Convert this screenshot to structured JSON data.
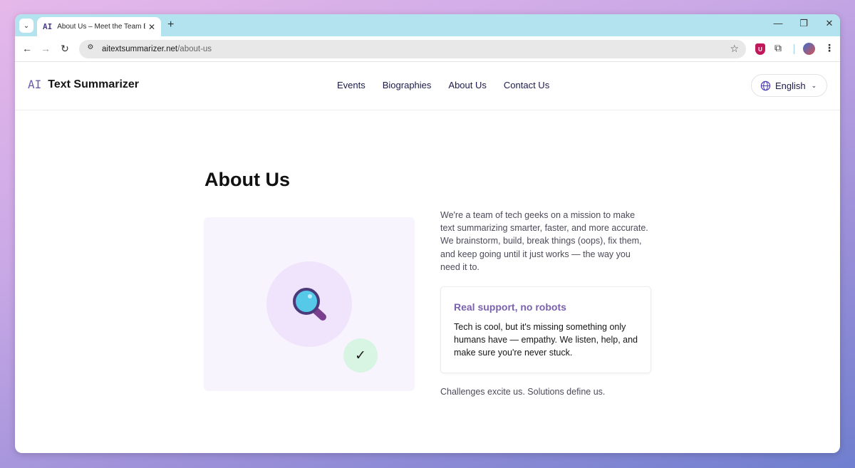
{
  "browser": {
    "tab": {
      "favicon": "AI",
      "title": "About Us – Meet the Team Behi",
      "close_glyph": "✕"
    },
    "new_tab_glyph": "+",
    "tab_menu_glyph": "⌄",
    "window_controls": {
      "minimize": "—",
      "restore": "❐",
      "close": "✕"
    },
    "nav": {
      "back": "←",
      "forward": "→",
      "reload": "↻"
    },
    "address": {
      "host": "aitextsummarizer.net",
      "path": "/about-us"
    },
    "star_glyph": "☆",
    "ublock_label": "U",
    "kebab_glyph": "⋮",
    "puzzle_glyph": "⧉",
    "site_info_glyph": "⚙"
  },
  "site": {
    "logo_mark": "AI",
    "logo_text": "Text Summarizer",
    "nav": [
      {
        "label": "Events"
      },
      {
        "label": "Biographies"
      },
      {
        "label": "About Us"
      },
      {
        "label": "Contact Us"
      }
    ],
    "language": {
      "label": "English",
      "chevron": "⌄"
    }
  },
  "main": {
    "title": "About Us",
    "intro": "We're a team of tech geeks on a mission to make text summarizing smarter, faster, and more accurate. We brainstorm, build, break things (oops), fix them, and keep going until it just works — the way you need it to.",
    "card": {
      "title": "Real support, no robots",
      "body": "Tech is cool, but it's missing something only humans have — empathy. We listen, help, and make sure you're never stuck."
    },
    "tagline": "Challenges excite us. Solutions define us.",
    "check_glyph": "✓"
  },
  "colors": {
    "tabstrip": "#b4e3f0",
    "accent": "#7a62ad",
    "nav_text": "#1c1a4a",
    "illustration_bg": "#f8f4fd",
    "check_bg": "#d8f4e3"
  }
}
